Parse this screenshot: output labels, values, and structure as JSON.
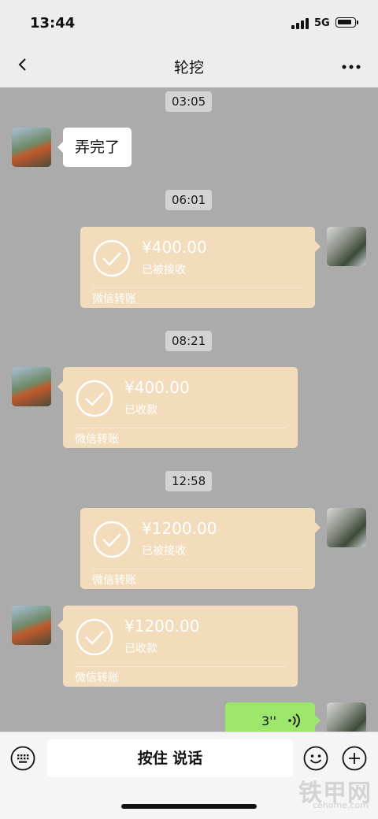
{
  "status_bar": {
    "time": "13:44",
    "network": "5G"
  },
  "nav": {
    "title": "轮挖"
  },
  "messages": [
    {
      "type": "time",
      "text": "03:05"
    },
    {
      "type": "text",
      "side": "left",
      "text": "弄完了"
    },
    {
      "type": "time",
      "text": "06:01"
    },
    {
      "type": "transfer",
      "side": "right",
      "amount": "¥400.00",
      "status": "已被接收",
      "footer": "微信转账"
    },
    {
      "type": "time",
      "text": "08:21"
    },
    {
      "type": "transfer",
      "side": "left",
      "amount": "¥400.00",
      "status": "已收款",
      "footer": "微信转账"
    },
    {
      "type": "time",
      "text": "12:58"
    },
    {
      "type": "transfer",
      "side": "right",
      "amount": "¥1200.00",
      "status": "已被接收",
      "footer": "微信转账"
    },
    {
      "type": "transfer",
      "side": "left",
      "amount": "¥1200.00",
      "status": "已收款",
      "footer": "微信转账"
    },
    {
      "type": "voice",
      "side": "right",
      "duration": "3''"
    }
  ],
  "input_bar": {
    "hold_to_talk": "按住 说话"
  },
  "watermark": {
    "main": "铁甲网",
    "sub": "cehome.com"
  },
  "colors": {
    "transfer": "#f2dcbc",
    "voice": "#9de66c",
    "chat_bg": "#ababab"
  },
  "icons": [
    "back-icon",
    "more-icon",
    "check-icon",
    "voice-icon",
    "keyboard-icon",
    "emoji-icon",
    "plus-icon"
  ]
}
